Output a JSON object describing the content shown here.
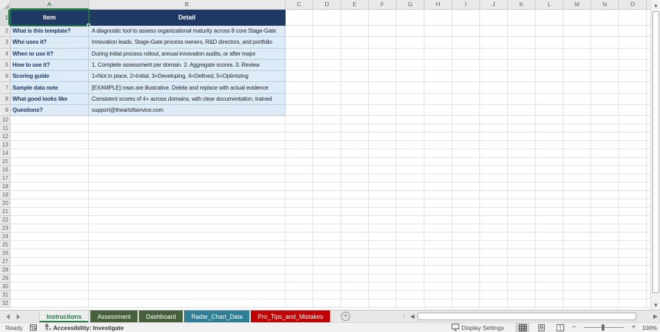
{
  "grid": {
    "column_letters": [
      "A",
      "B",
      "C",
      "D",
      "E",
      "F",
      "G",
      "H",
      "I",
      "J",
      "K",
      "L",
      "M",
      "N",
      "O"
    ],
    "row_numbers": [
      1,
      2,
      3,
      4,
      5,
      6,
      7,
      8,
      9,
      10,
      11,
      12,
      13,
      14,
      15,
      16,
      17,
      18,
      19,
      20,
      21,
      22,
      23,
      24,
      25,
      26,
      27,
      28,
      29,
      30,
      31,
      32
    ],
    "selected_cell": "A1"
  },
  "table": {
    "header": {
      "item": "Item",
      "detail": "Detail"
    },
    "rows": [
      {
        "item": "What is this template?",
        "detail": "A diagnostic tool to assess organizational maturity across 8 core Stage-Gate"
      },
      {
        "item": "Who uses it?",
        "detail": "Innovation leads, Stage-Gate process owners, R&D directors, and portfolio"
      },
      {
        "item": "When to use it?",
        "detail": "During initial process rollout, annual innovation audits, or after major"
      },
      {
        "item": "How to use it?",
        "detail": "1. Complete assessment per domain. 2. Aggregate scores. 3. Review"
      },
      {
        "item": "Scoring guide",
        "detail": "1=Not in place, 2=Initial, 3=Developing, 4=Defined, 5=Optimizing"
      },
      {
        "item": "Sample data note",
        "detail": "[EXAMPLE] rows are illustrative. Delete and replace with actual evidence"
      },
      {
        "item": "What good looks like",
        "detail": "Consistent scores of 4+ across domains, with clear documentation, trained"
      },
      {
        "item": "Questions?",
        "detail": "support@theartofservice.com"
      }
    ]
  },
  "sheet_tabs": {
    "tabs": [
      {
        "label": "Instructions",
        "active": true,
        "bg": "#EDEFEE",
        "text_color": "#217346"
      },
      {
        "label": "Assessment",
        "active": false,
        "bg": "#45603A",
        "text_color": "#FFFFFF"
      },
      {
        "label": "Dashboard",
        "active": false,
        "bg": "#45603A",
        "text_color": "#FFFFFF"
      },
      {
        "label": "Radar_Chart_Data",
        "active": false,
        "bg": "#2E7F95",
        "text_color": "#FFFFFF"
      },
      {
        "label": "Pro_Tips_and_Mistakes",
        "active": false,
        "bg": "#C00000",
        "text_color": "#FFFFFF"
      }
    ],
    "add_sheet_label": "+"
  },
  "status_bar": {
    "ready_label": "Ready",
    "accessibility_label": "Accessibility: Investigate",
    "display_settings_label": "Display Settings",
    "zoom_level": "100%",
    "zoom_minus": "−",
    "zoom_plus": "+"
  },
  "colors": {
    "table_header_bg": "#1F3864",
    "table_row_bg": "#DDEBF7",
    "item_text": "#1F3864",
    "selection_green": "#217346"
  }
}
